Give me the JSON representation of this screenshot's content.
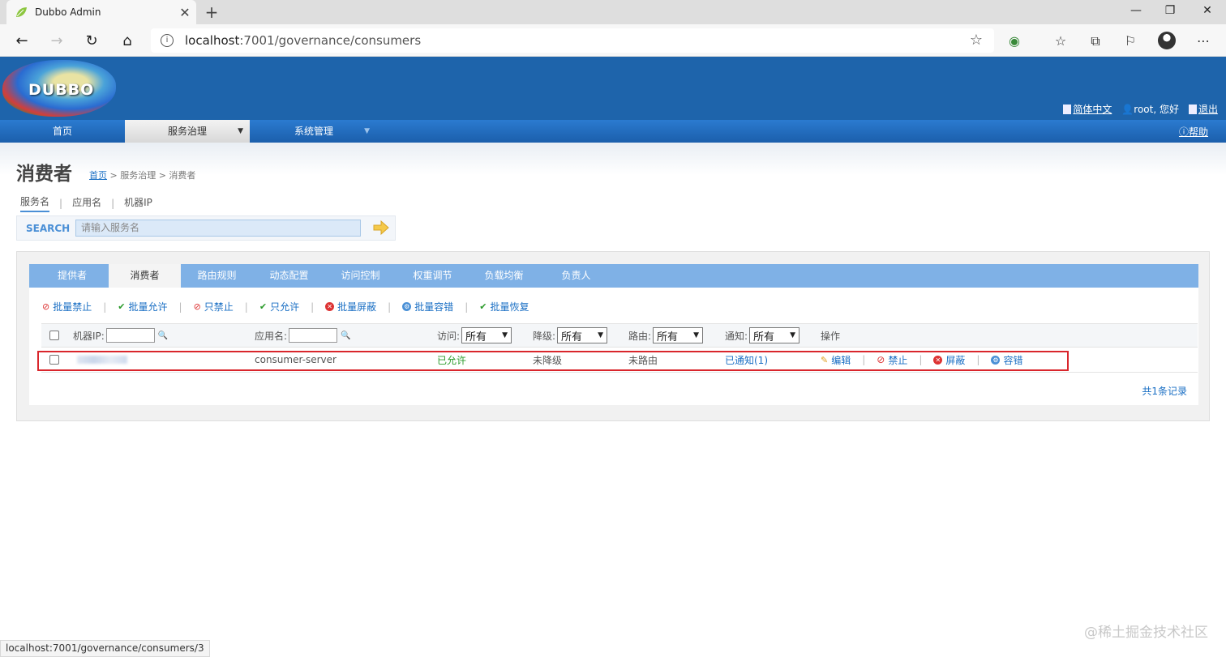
{
  "browser": {
    "tab_title": "Dubbo Admin",
    "url_host": "localhost",
    "url_path": ":7001/governance/consumers",
    "status_url": "localhost:7001/governance/consumers/3"
  },
  "header": {
    "logo_text": "DUBBO",
    "lang": "简体中文",
    "user": "root, 您好",
    "logout": "退出",
    "help": "帮助"
  },
  "mainnav": {
    "home": "首页",
    "governance": "服务治理",
    "system": "系统管理"
  },
  "page": {
    "title": "消费者",
    "crumb_home": "首页",
    "crumb_rest": " > 服务治理 > 消费者"
  },
  "search": {
    "tabs": [
      "服务名",
      "应用名",
      "机器IP"
    ],
    "label": "SEARCH",
    "placeholder": "请输入服务名"
  },
  "tabs": [
    "提供者",
    "消费者",
    "路由规则",
    "动态配置",
    "访问控制",
    "权重调节",
    "负载均衡",
    "负责人"
  ],
  "actions": [
    "批量禁止",
    "批量允许",
    "只禁止",
    "只允许",
    "批量屏蔽",
    "批量容错",
    "批量恢复"
  ],
  "table": {
    "headers": {
      "ip": "机器IP:",
      "app": "应用名:",
      "access": "访问:",
      "degrade": "降级:",
      "route": "路由:",
      "notify": "通知:",
      "ops": "操作"
    },
    "filter_value": "所有",
    "row": {
      "app": "consumer-server",
      "access": "已允许",
      "degrade": "未降级",
      "route": "未路由",
      "notify": "已通知(1)",
      "ops": [
        "编辑",
        "禁止",
        "屏蔽",
        "容错"
      ]
    },
    "total": "共1条记录"
  },
  "watermark": "@稀土掘金技术社区",
  "colors": {
    "header_blue": "#1e64ab",
    "tab_blue": "#7fb1e6",
    "link_blue": "#1a6fc4",
    "allowed_green": "#2a9a2a",
    "highlight_red": "#d9262c"
  }
}
